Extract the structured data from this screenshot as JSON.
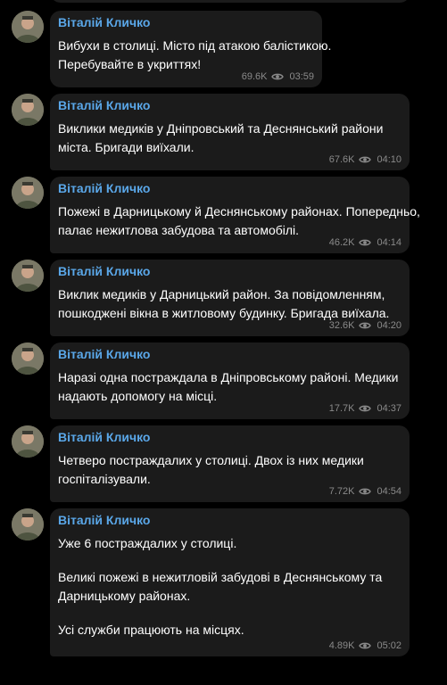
{
  "theme": {
    "background": "#000000",
    "bubble": "#1b1b1b",
    "sender_color": "#5aa7e8",
    "text_color": "#ffffff",
    "meta_color": "#8a8a8a"
  },
  "messages": [
    {
      "sender": "Віталій Кличко",
      "lines": [
        "Вибухи в столиці. Місто під атакою балістикою.",
        "Перебувайте в укриттях!"
      ],
      "views": "69.6K",
      "time": "03:59"
    },
    {
      "sender": "Віталій Кличко",
      "lines": [
        "Виклики медиків у Дніпровський та Деснянський райони",
        "міста. Бригади виїхали."
      ],
      "views": "67.6K",
      "time": "04:10"
    },
    {
      "sender": "Віталій Кличко",
      "lines": [
        "Пожежі в Дарницькому й Деснянському районах. Попередньо,",
        "палає нежитлова забудова та автомобілі."
      ],
      "views": "46.2K",
      "time": "04:14"
    },
    {
      "sender": "Віталій Кличко",
      "lines": [
        "Виклик медиків у Дарницький район. За повідомленням,",
        "пошкоджені вікна в житловому будинку. Бригада виїхала."
      ],
      "views": "32.6K",
      "time": "04:20"
    },
    {
      "sender": "Віталій Кличко",
      "lines": [
        "Наразі одна постраждала в Дніпровському районі. Медики",
        "надають допомогу на місці."
      ],
      "views": "17.7K",
      "time": "04:37"
    },
    {
      "sender": "Віталій Кличко",
      "lines": [
        "Четверо постраждалих у столиці. Двох із них медики",
        "госпіталізували."
      ],
      "views": "7.72K",
      "time": "04:54"
    },
    {
      "sender": "Віталій Кличко",
      "paragraphs": [
        [
          "Уже 6 постраждалих у столиці."
        ],
        [
          "Великі пожежі в нежитловій забудові в Деснянському та",
          "Дарницькому районах."
        ],
        [
          "Усі служби працюють на місцях."
        ]
      ],
      "views": "4.89K",
      "time": "05:02"
    }
  ]
}
